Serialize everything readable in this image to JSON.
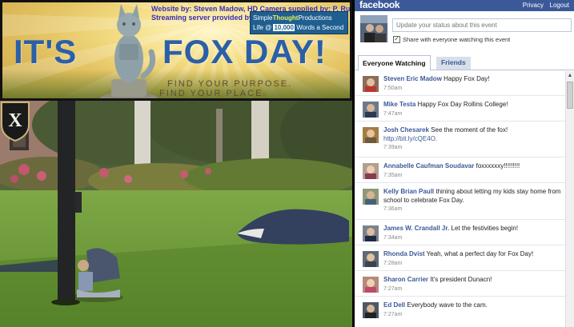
{
  "banner": {
    "credit_line_1": "Website by:  Steven Madow, HD Camera supplied by: P. Russo",
    "credit_line_2": "Streaming server provided by:",
    "simple_thought": {
      "simple": "Simple",
      "thought": "Thought",
      "productions": "Productions",
      "life_at": "Life @",
      "ten_thousand": "10,000",
      "words": "Words a Second"
    },
    "headline_left": "IT'S",
    "headline_right": "FOX DAY!",
    "tagline_1": "FIND YOUR PURPOSE.",
    "tagline_2": "FIND YOUR PLACE."
  },
  "camera": {
    "badge_letter": "X"
  },
  "facebook": {
    "logo": "facebook",
    "privacy": "Privacy",
    "logout": "Logout",
    "status_placeholder": "Update your status about this event",
    "share_label": "Share with everyone watching this event",
    "tabs": [
      "Everyone Watching",
      "Friends"
    ],
    "colors": {
      "brand": "#3b5998",
      "tab_inactive_bg": "#d8dfea"
    },
    "posts": [
      {
        "name": "Steven Eric Madow",
        "message": "Happy Fox Day!",
        "time": "7:50am"
      },
      {
        "name": "Mike Testa",
        "message": "Happy Fox Day Rollins College!",
        "time": "7:47am"
      },
      {
        "name": "Josh Chesarek",
        "message": "See the moment of the fox!",
        "link": "http://bit.ly/cQE4O.",
        "time": "7:39am"
      },
      {
        "name": "Annabelle Caufman Soudavar",
        "message": "foxxxxxxy!!!!!!!!!",
        "time": "7:35am"
      },
      {
        "name": "Kelly Brian Paull",
        "message": "thining about letting my kids stay home from school to celebrate Fox Day.",
        "time": "7:36am"
      },
      {
        "name": "James W. Crandall Jr.",
        "message": "Let the festivities begin!",
        "time": "7:34am"
      },
      {
        "name": "Rhonda Dvist",
        "message": "Yeah, what a perfect day for Fox Day!",
        "time": "7:28am"
      },
      {
        "name": "Sharon Carrier",
        "message": "It's president Dunacn!",
        "time": "7:27am"
      },
      {
        "name": "Ed Dell",
        "message": "Everybody wave to the cam.",
        "time": "7:27am"
      }
    ]
  }
}
